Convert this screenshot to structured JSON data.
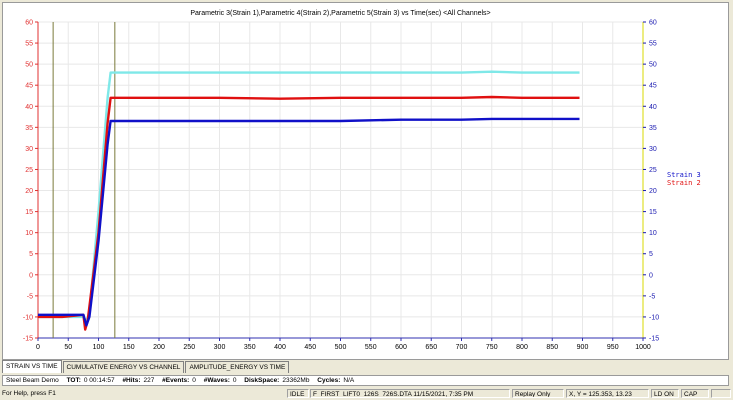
{
  "tabs": [
    {
      "label": "STRAIN VS TIME",
      "active": true
    },
    {
      "label": "CUMULATIVE ENERGY VS CHANNEL",
      "active": false
    },
    {
      "label": "AMPLITUDE_ENERGY VS TIME",
      "active": false
    }
  ],
  "status_line": {
    "demo": "Steel Beam Demo",
    "tot_label": "TOT:",
    "tot_value": "0 00:14:57",
    "hits_label": "#Hits:",
    "hits_value": "227",
    "events_label": "#Events:",
    "events_value": "0",
    "waves_label": "#Waves:",
    "waves_value": "0",
    "disk_label": "DiskSpace:",
    "disk_value": "23362Mb",
    "cycles_label": "Cycles:",
    "cycles_value": "N/A"
  },
  "statusbar": {
    "help": "For Help, press F1",
    "state": "IDLE",
    "file": "F_FIRST_LIFT0_126S_726S.DTA  11/15/2021, 7:35 PM",
    "mode": "Replay Only",
    "coords": "X, Y = 125.353, 13.23",
    "ld": "LD ON",
    "cap": "CAP"
  },
  "colors": {
    "strain1": "#7fe8e8",
    "strain2": "#e01010",
    "strain3": "#1010c8",
    "left_axis": "#e03030",
    "right_axis": "#1818b0",
    "grid": "#e8e8e8",
    "cursor": "#7a7a3a"
  },
  "chart_data": {
    "type": "line",
    "title": "Parametric 3(Strain 1),Parametric 4(Strain 2),Parametric 5(Strain 3) vs Time(sec) <All Channels>",
    "xlabel": "",
    "ylabel": "",
    "xlim": [
      0,
      1000
    ],
    "ylim_left": [
      -15,
      60
    ],
    "ylim_right": [
      -15,
      60
    ],
    "x_ticks": [
      0,
      50,
      100,
      150,
      200,
      250,
      300,
      350,
      400,
      450,
      500,
      550,
      600,
      650,
      700,
      750,
      800,
      850,
      900,
      950,
      1000
    ],
    "y_ticks_left": [
      -15,
      -10,
      -5,
      0,
      5,
      10,
      15,
      20,
      25,
      30,
      35,
      40,
      45,
      50,
      55,
      60
    ],
    "y_ticks_right": [
      -15,
      -10,
      -5,
      0,
      5,
      10,
      15,
      20,
      25,
      30,
      35,
      40,
      45,
      50,
      55,
      60
    ],
    "cursor_lines_x": [
      25,
      127
    ],
    "grid": true,
    "legend_placement": "right",
    "legend": [
      "Strain 3",
      "Strain 2"
    ],
    "series": [
      {
        "name": "Strain 1",
        "x": [
          0,
          40,
          75,
          80,
          85,
          100,
          115,
          120,
          200,
          300,
          400,
          500,
          600,
          700,
          750,
          800,
          895
        ],
        "y": [
          -10,
          -10,
          -10,
          -11,
          -9,
          15,
          42,
          48,
          48,
          48,
          48,
          48,
          48,
          48,
          48.2,
          48,
          48
        ]
      },
      {
        "name": "Strain 2",
        "x": [
          0,
          40,
          75,
          78,
          82,
          100,
          115,
          120,
          200,
          300,
          400,
          500,
          600,
          700,
          750,
          800,
          895
        ],
        "y": [
          -10,
          -10,
          -9.5,
          -13,
          -11,
          10,
          36,
          42,
          42,
          42,
          41.8,
          42,
          42,
          42,
          42.2,
          42,
          42
        ]
      },
      {
        "name": "Strain 3",
        "x": [
          0,
          40,
          75,
          80,
          85,
          100,
          115,
          120,
          200,
          300,
          400,
          500,
          600,
          700,
          750,
          800,
          895
        ],
        "y": [
          -9.5,
          -9.5,
          -9.5,
          -12,
          -10,
          8,
          31,
          36.5,
          36.5,
          36.5,
          36.5,
          36.5,
          36.8,
          36.8,
          37,
          37,
          37
        ]
      }
    ]
  }
}
